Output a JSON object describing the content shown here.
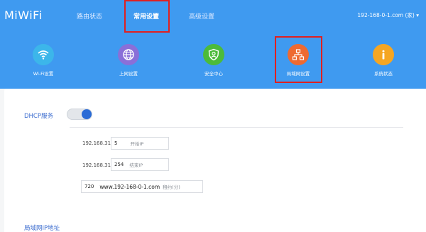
{
  "logo": "MiWiFi",
  "nav": {
    "tabs": [
      {
        "label": "路由状态"
      },
      {
        "label": "常用设置"
      },
      {
        "label": "高级设置"
      }
    ],
    "device": "192-168-0-1.com (家) ▾"
  },
  "icons": [
    {
      "label": "Wi-Fi设置",
      "color": "#3cb6ea"
    },
    {
      "label": "上网设置",
      "color": "#8a6fd8"
    },
    {
      "label": "安全中心",
      "color": "#4cbb3a"
    },
    {
      "label": "局域网设置",
      "color": "#ee6a31"
    },
    {
      "label": "系统状态",
      "color": "#f5a623"
    }
  ],
  "dhcp": {
    "title": "DHCP服务",
    "prefix1": "192.168.31.",
    "start_value": "5",
    "start_placeholder": "开始IP",
    "prefix2": "192.168.31.",
    "end_value": "254",
    "end_placeholder": "结束IP",
    "lease_value": "720",
    "lease_site": "www.192-168-0-1.com",
    "lease_placeholder": "租约(分)"
  },
  "lan": {
    "title": "局域网IP地址"
  },
  "colors": {
    "header_blue": "#3f9af0",
    "highlight_red": "#e02020",
    "toggle_on": "#2a6bd6",
    "section_title": "#3f6fd0"
  }
}
